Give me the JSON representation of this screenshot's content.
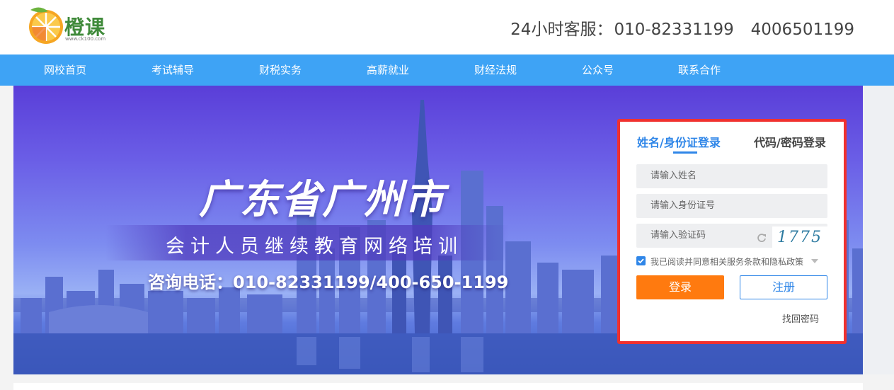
{
  "header": {
    "logo_text": "橙课",
    "logo_url": "www.ck100.com",
    "hotline_label": "24小时客服：",
    "hotline_number_1": "010-82331199",
    "hotline_number_2": "4006501199"
  },
  "nav": {
    "items": [
      {
        "label": "网校首页"
      },
      {
        "label": "考试辅导"
      },
      {
        "label": "财税实务"
      },
      {
        "label": "高薪就业"
      },
      {
        "label": "财经法规"
      },
      {
        "label": "公众号"
      },
      {
        "label": "联系合作"
      }
    ]
  },
  "banner": {
    "title": "广东省广州市",
    "subtitle": "会计人员继续教育网络培训",
    "phone": "咨询电话：010-82331199/400-650-1199"
  },
  "login": {
    "tab_active": "姓名/身份证登录",
    "tab_inactive": "代码/密码登录",
    "name_placeholder": "请输入姓名",
    "id_placeholder": "请输入身份证号",
    "captcha_placeholder": "请输入验证码",
    "captcha_code": "1775",
    "agree_text": "我已阅读并同意相关服务条款和隐私政策",
    "login_button": "登录",
    "register_button": "注册",
    "forgot_link": "找回密码"
  },
  "colors": {
    "nav_bg": "#3ea3f5",
    "login_btn": "#ff7a0f",
    "accent_blue": "#2f86e8",
    "highlight_border": "#f0312f"
  }
}
